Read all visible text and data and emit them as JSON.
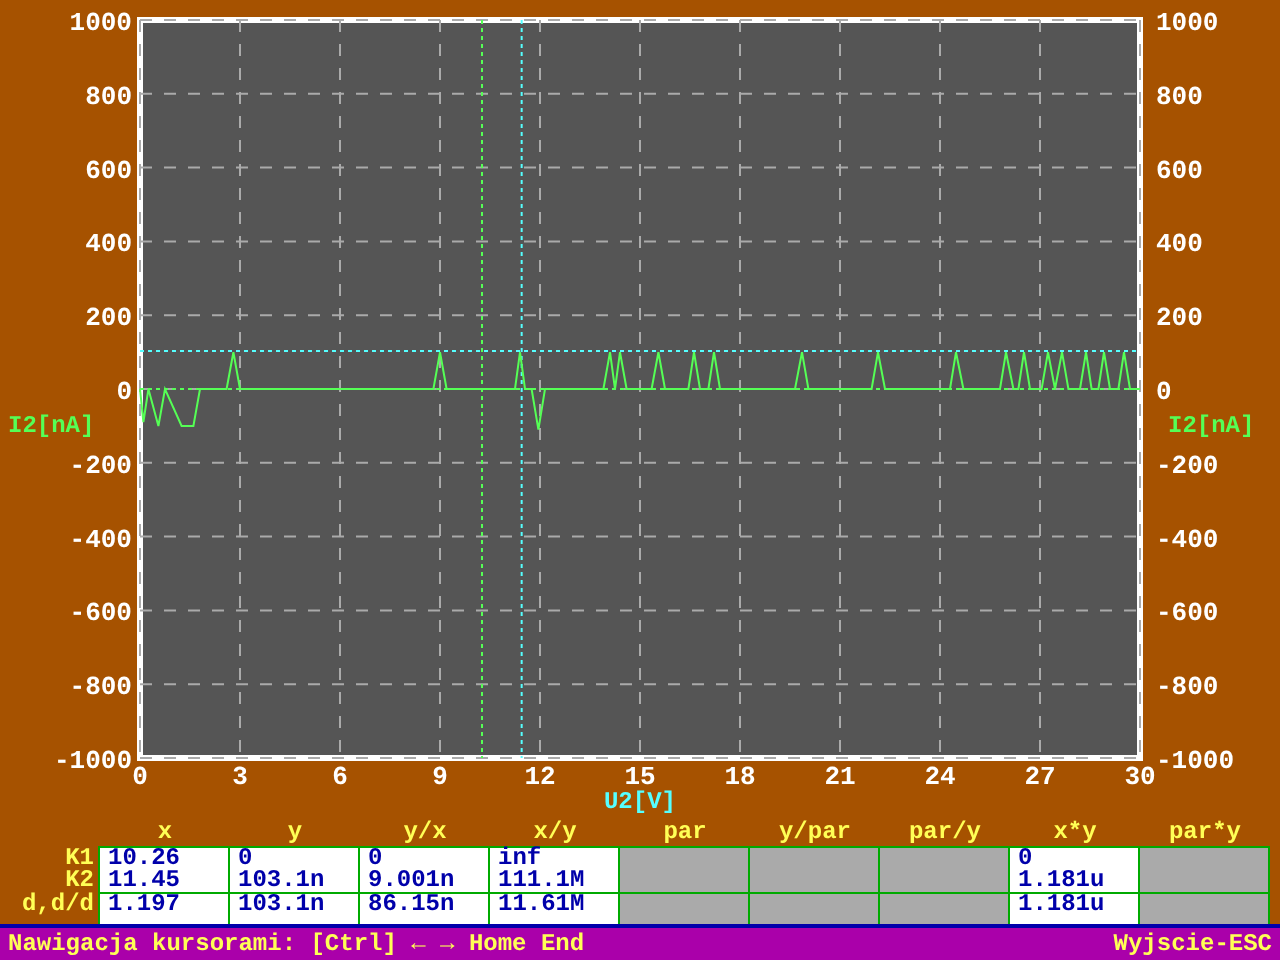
{
  "chart": {
    "chart_data": {
      "type": "line",
      "xlabel": "U2[V]",
      "ylabel": "I2[nA]",
      "xlim": [
        0,
        30
      ],
      "ylim": [
        -1000,
        1000
      ],
      "xticks": [
        0,
        3,
        6,
        9,
        12,
        15,
        18,
        21,
        24,
        27,
        30
      ],
      "yticks": [
        -1000,
        -800,
        -600,
        -400,
        -200,
        0,
        200,
        400,
        600,
        800,
        1000
      ],
      "x": [
        0,
        0.1,
        0.25,
        0.55,
        0.75,
        1.25,
        1.6,
        1.8,
        2.6,
        2.8,
        3.0,
        8.8,
        9.0,
        9.2,
        11.25,
        11.4,
        11.55,
        11.75,
        11.95,
        12.15,
        13.9,
        14.1,
        14.25,
        14.4,
        14.6,
        15.35,
        15.55,
        15.75,
        16.45,
        16.62,
        16.8,
        17.05,
        17.22,
        17.4,
        19.65,
        19.86,
        20.05,
        21.95,
        22.14,
        22.35,
        24.3,
        24.48,
        24.7,
        25.8,
        25.98,
        26.2,
        26.35,
        26.52,
        26.7,
        27.05,
        27.24,
        27.45,
        27.66,
        27.85,
        28.2,
        28.38,
        28.55,
        28.75,
        28.92,
        29.1,
        29.35,
        29.52,
        29.7,
        30
      ],
      "series": [
        {
          "name": "I2[nA]",
          "color": "#55ff55",
          "values": [
            0,
            -90,
            0,
            -100,
            0,
            -100,
            -100,
            0,
            0,
            100,
            0,
            0,
            100,
            0,
            0,
            100,
            0,
            0,
            -110,
            0,
            0,
            100,
            0,
            100,
            0,
            0,
            100,
            0,
            0,
            100,
            0,
            0,
            100,
            0,
            0,
            100,
            0,
            0,
            100,
            0,
            0,
            100,
            0,
            0,
            100,
            0,
            0,
            100,
            0,
            0,
            100,
            0,
            100,
            0,
            0,
            100,
            0,
            0,
            100,
            0,
            0,
            100,
            0,
            0
          ]
        }
      ],
      "grid": true,
      "ref_lines": [
        {
          "axis": "x",
          "value": 10.26,
          "color": "#55ff55"
        },
        {
          "axis": "x",
          "value": 11.45,
          "color": "#55ffff"
        },
        {
          "axis": "y",
          "value": 0,
          "color": "#55ff55"
        },
        {
          "axis": "y",
          "value": 103.1,
          "color": "#55ffff"
        }
      ]
    },
    "right_axis_labels": [
      "1000",
      "800",
      "600",
      "400",
      "200",
      "0",
      "-200",
      "-400",
      "-600",
      "-800",
      "-1000"
    ]
  },
  "table": {
    "row_labels": [
      "K1",
      "K2",
      "d,d/d"
    ],
    "columns": [
      {
        "header": "x",
        "disabled": false,
        "k1": "10.26",
        "k2": "11.45",
        "d": "1.197"
      },
      {
        "header": "y",
        "disabled": false,
        "k1": "0",
        "k2": "103.1n",
        "d": "103.1n"
      },
      {
        "header": "y/x",
        "disabled": false,
        "k1": "0",
        "k2": "9.001n",
        "d": "86.15n"
      },
      {
        "header": "x/y",
        "disabled": false,
        "k1": "inf",
        "k2": "111.1M",
        "d": "11.61M"
      },
      {
        "header": "par",
        "disabled": true
      },
      {
        "header": "y/par",
        "disabled": true
      },
      {
        "header": "par/y",
        "disabled": true
      },
      {
        "header": "x*y",
        "disabled": false,
        "k1": "0",
        "k2": "1.181u",
        "d": "1.181u"
      },
      {
        "header": "par*y",
        "disabled": true
      }
    ]
  },
  "status_bar": {
    "hint": "Nawigacja kursorami: [Ctrl] ← → Home End",
    "exit": "Wyjscie-ESC"
  }
}
